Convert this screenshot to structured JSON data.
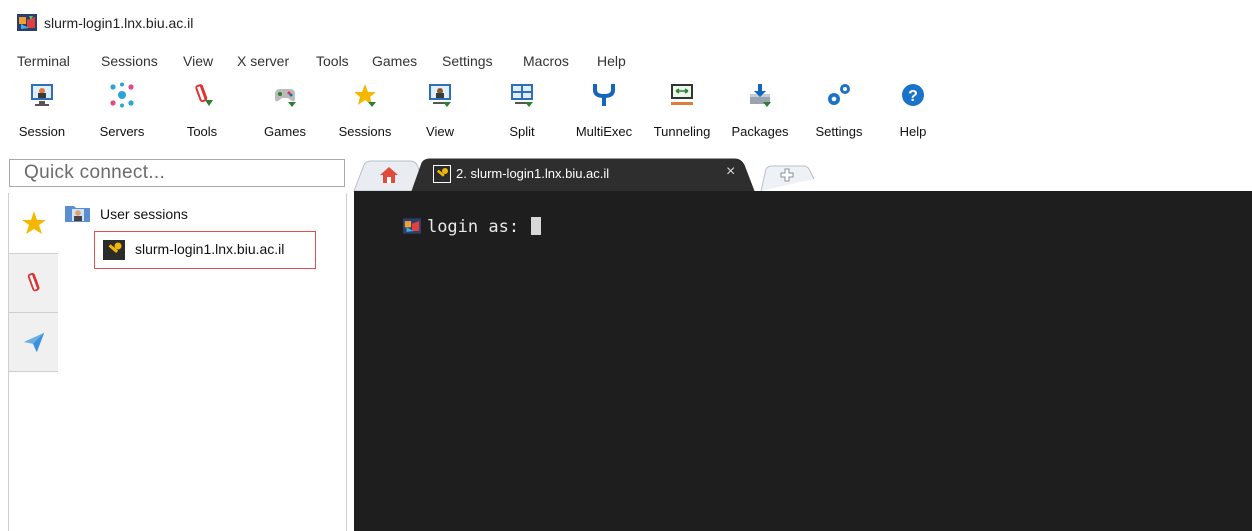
{
  "window": {
    "title": "slurm-login1.lnx.biu.ac.il"
  },
  "menu": [
    "Terminal",
    "Sessions",
    "View",
    "X server",
    "Tools",
    "Games",
    "Settings",
    "Macros",
    "Help"
  ],
  "toolbar": [
    {
      "label": "Session",
      "icon": "session-icon"
    },
    {
      "label": "Servers",
      "icon": "servers-icon"
    },
    {
      "label": "Tools",
      "icon": "tools-icon"
    },
    {
      "label": "Games",
      "icon": "games-icon"
    },
    {
      "label": "Sessions",
      "icon": "star-icon"
    },
    {
      "label": "View",
      "icon": "view-icon"
    },
    {
      "label": "Split",
      "icon": "split-icon"
    },
    {
      "label": "MultiExec",
      "icon": "multiexec-icon"
    },
    {
      "label": "Tunneling",
      "icon": "tunneling-icon"
    },
    {
      "label": "Packages",
      "icon": "packages-icon"
    },
    {
      "label": "Settings",
      "icon": "gears-icon"
    },
    {
      "label": "Help",
      "icon": "help-icon"
    }
  ],
  "quick_connect": {
    "placeholder": "Quick connect..."
  },
  "sessions_tree": {
    "root": "User sessions",
    "items": [
      "slurm-login1.lnx.biu.ac.il"
    ]
  },
  "tabs": {
    "active": "2. slurm-login1.lnx.biu.ac.il",
    "close_glyph": "×"
  },
  "terminal": {
    "prompt": "login as: "
  },
  "colors": {
    "accent": "#3b8fe0",
    "terminal_bg": "#1e1e1e",
    "highlight_border": "#e0504f"
  }
}
